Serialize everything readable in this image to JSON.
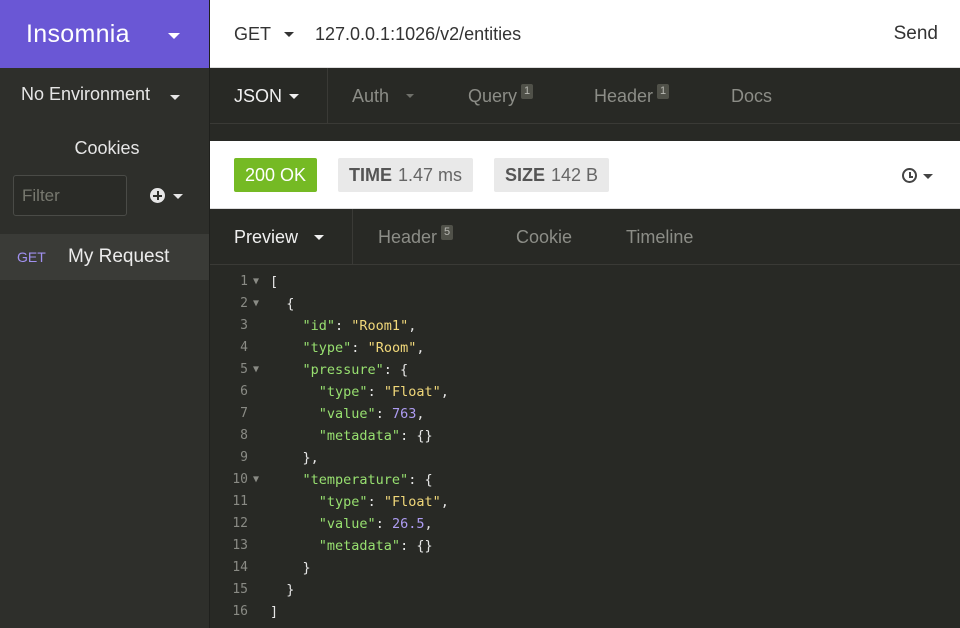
{
  "sidebar": {
    "brand": "Insomnia",
    "environment": "No Environment",
    "cookies": "Cookies",
    "filter_placeholder": "Filter",
    "requests": [
      {
        "method": "GET",
        "name": "My Request"
      }
    ]
  },
  "request": {
    "method": "GET",
    "url": "127.0.0.1:1026/v2/entities",
    "send_label": "Send",
    "tabs": {
      "body": "JSON",
      "auth": "Auth",
      "query": "Query",
      "query_count": "1",
      "header": "Header",
      "header_count": "1",
      "docs": "Docs"
    }
  },
  "response": {
    "status": "200 OK",
    "time_label": "TIME",
    "time_value": "1.47 ms",
    "size_label": "SIZE",
    "size_value": "142 B",
    "tabs": {
      "preview": "Preview",
      "header": "Header",
      "header_count": "5",
      "cookie": "Cookie",
      "timeline": "Timeline"
    },
    "lines": [
      {
        "n": "1",
        "fold": true
      },
      {
        "n": "2",
        "fold": true
      },
      {
        "n": "3",
        "fold": false
      },
      {
        "n": "4",
        "fold": false
      },
      {
        "n": "5",
        "fold": true
      },
      {
        "n": "6",
        "fold": false
      },
      {
        "n": "7",
        "fold": false
      },
      {
        "n": "8",
        "fold": false
      },
      {
        "n": "9",
        "fold": false
      },
      {
        "n": "10",
        "fold": true
      },
      {
        "n": "11",
        "fold": false
      },
      {
        "n": "12",
        "fold": false
      },
      {
        "n": "13",
        "fold": false
      },
      {
        "n": "14",
        "fold": false
      },
      {
        "n": "15",
        "fold": false
      },
      {
        "n": "16",
        "fold": false
      }
    ],
    "json": {
      "id_key": "\"id\"",
      "id_val": "\"Room1\"",
      "type_key": "\"type\"",
      "type_val": "\"Room\"",
      "pressure_key": "\"pressure\"",
      "p_type_key": "\"type\"",
      "p_type_val": "\"Float\"",
      "p_value_key": "\"value\"",
      "p_value_val": "763",
      "p_meta_key": "\"metadata\"",
      "temperature_key": "\"temperature\"",
      "t_type_key": "\"type\"",
      "t_type_val": "\"Float\"",
      "t_value_key": "\"value\"",
      "t_value_val": "26.5",
      "t_meta_key": "\"metadata\""
    }
  },
  "colors": {
    "brand": "#6a57d5",
    "status_ok": "#75ba24",
    "json_key": "#98e070",
    "json_string": "#f1d87a",
    "json_number": "#ae9cf2"
  }
}
